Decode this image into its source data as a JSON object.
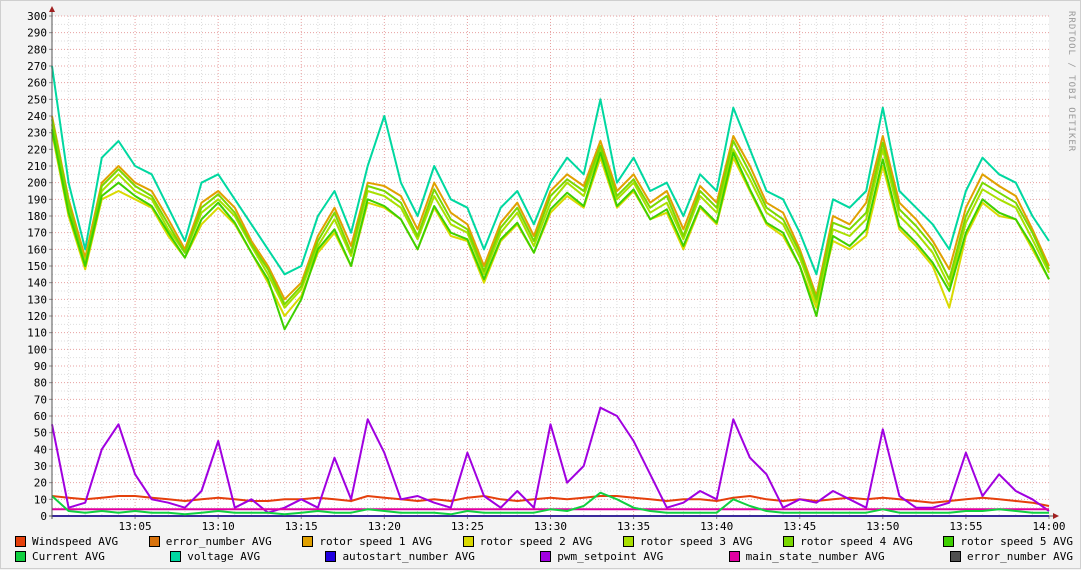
{
  "watermark": "RRDTOOL / TOBI OETIKER",
  "chart_data": {
    "type": "line",
    "title": "",
    "xlabel": "",
    "ylabel": "",
    "ylim": [
      0,
      300
    ],
    "yticks": [
      "0",
      "10",
      "20",
      "30",
      "40",
      "50",
      "60",
      "70",
      "80",
      "90",
      "100",
      "110",
      "120",
      "130",
      "140",
      "150",
      "160",
      "170",
      "180",
      "190",
      "200",
      "210",
      "220",
      "230",
      "240",
      "250",
      "260",
      "270",
      "280",
      "290",
      "300"
    ],
    "xrange_minutes": [
      0,
      60
    ],
    "xticks": [
      {
        "minute": 5,
        "label": "13:05"
      },
      {
        "minute": 10,
        "label": "13:10"
      },
      {
        "minute": 15,
        "label": "13:15"
      },
      {
        "minute": 20,
        "label": "13:20"
      },
      {
        "minute": 25,
        "label": "13:25"
      },
      {
        "minute": 30,
        "label": "13:30"
      },
      {
        "minute": 35,
        "label": "13:35"
      },
      {
        "minute": 40,
        "label": "13:40"
      },
      {
        "minute": 45,
        "label": "13:45"
      },
      {
        "minute": 50,
        "label": "13:50"
      },
      {
        "minute": 55,
        "label": "13:55"
      },
      {
        "minute": 60,
        "label": "14:00"
      }
    ],
    "grid": true,
    "legend_placement": "bottom",
    "series": [
      {
        "name": "Windspeed AVG",
        "color": "#e5400c",
        "values": [
          12,
          11,
          10,
          11,
          12,
          12,
          11,
          10,
          9,
          10,
          11,
          10,
          9,
          9,
          10,
          10,
          11,
          10,
          9,
          12,
          11,
          10,
          9,
          10,
          9,
          11,
          12,
          10,
          9,
          10,
          11,
          10,
          11,
          12,
          12,
          11,
          10,
          9,
          10,
          10,
          9,
          11,
          12,
          10,
          9,
          10,
          9,
          10,
          11,
          10,
          11,
          10,
          9,
          8,
          9,
          10,
          11,
          10,
          9,
          8,
          6
        ]
      },
      {
        "name": "error_number AVG",
        "color": "#d8720c",
        "values": [
          0,
          0,
          0,
          0,
          0,
          0,
          0,
          0,
          0,
          0,
          0,
          0,
          0,
          0,
          0,
          0,
          0,
          0,
          0,
          0,
          0,
          0,
          0,
          0,
          0,
          0,
          0,
          0,
          0,
          0,
          0,
          0,
          0,
          0,
          0,
          0,
          0,
          0,
          0,
          0,
          0,
          0,
          0,
          0,
          0,
          0,
          0,
          0,
          0,
          0,
          0,
          0,
          0,
          0,
          0,
          0,
          0,
          0,
          0,
          0,
          0
        ]
      },
      {
        "name": "rotor speed 1 AVG",
        "color": "#e0a000",
        "values": [
          240,
          190,
          155,
          200,
          210,
          200,
          195,
          178,
          160,
          188,
          195,
          185,
          165,
          150,
          130,
          140,
          168,
          185,
          162,
          200,
          198,
          192,
          172,
          200,
          182,
          175,
          150,
          176,
          188,
          168,
          195,
          205,
          198,
          225,
          195,
          205,
          188,
          195,
          172,
          198,
          188,
          228,
          210,
          188,
          182,
          160,
          132,
          180,
          175,
          188,
          228,
          188,
          178,
          165,
          148,
          185,
          205,
          198,
          192,
          172,
          150
        ]
      },
      {
        "name": "rotor speed 2 AVG",
        "color": "#d9d900",
        "values": [
          230,
          180,
          148,
          190,
          195,
          190,
          185,
          168,
          155,
          175,
          185,
          175,
          158,
          140,
          120,
          132,
          158,
          170,
          150,
          188,
          185,
          178,
          160,
          185,
          168,
          165,
          140,
          165,
          175,
          158,
          182,
          192,
          185,
          215,
          185,
          195,
          178,
          182,
          160,
          185,
          175,
          215,
          195,
          175,
          168,
          150,
          125,
          165,
          160,
          168,
          210,
          172,
          162,
          150,
          125,
          168,
          188,
          180,
          178,
          160,
          142
        ]
      },
      {
        "name": "rotor speed 3 AVG",
        "color": "#a8e000",
        "values": [
          235,
          185,
          152,
          195,
          205,
          195,
          190,
          172,
          158,
          182,
          190,
          180,
          162,
          145,
          125,
          136,
          162,
          178,
          156,
          195,
          192,
          185,
          166,
          192,
          175,
          170,
          145,
          170,
          182,
          162,
          188,
          200,
          192,
          220,
          190,
          200,
          182,
          188,
          166,
          192,
          182,
          220,
          202,
          182,
          175,
          155,
          128,
          172,
          168,
          178,
          220,
          180,
          170,
          158,
          138,
          176,
          196,
          190,
          185,
          166,
          146
        ]
      },
      {
        "name": "rotor speed 4 AVG",
        "color": "#7ad800",
        "values": [
          238,
          188,
          150,
          198,
          208,
          198,
          192,
          175,
          158,
          185,
          193,
          182,
          163,
          148,
          127,
          138,
          165,
          182,
          158,
          198,
          195,
          188,
          168,
          196,
          178,
          172,
          147,
          173,
          185,
          165,
          192,
          202,
          195,
          222,
          192,
          202,
          185,
          192,
          168,
          195,
          185,
          225,
          206,
          185,
          178,
          158,
          130,
          176,
          172,
          182,
          224,
          184,
          174,
          162,
          142,
          180,
          200,
          194,
          188,
          170,
          148
        ]
      },
      {
        "name": "rotor speed 5 AVG",
        "color": "#3ed000",
        "values": [
          232,
          182,
          150,
          192,
          200,
          192,
          186,
          170,
          155,
          178,
          188,
          176,
          158,
          142,
          112,
          130,
          160,
          172,
          150,
          190,
          186,
          178,
          160,
          186,
          170,
          166,
          142,
          166,
          176,
          158,
          184,
          194,
          186,
          218,
          186,
          196,
          178,
          184,
          162,
          186,
          176,
          218,
          196,
          176,
          170,
          150,
          120,
          168,
          162,
          172,
          214,
          174,
          164,
          152,
          135,
          170,
          190,
          182,
          178,
          162,
          142
        ]
      },
      {
        "name": "Current AVG",
        "color": "#10d040",
        "values": [
          12,
          3,
          2,
          3,
          2,
          3,
          2,
          2,
          1,
          2,
          3,
          2,
          2,
          2,
          1,
          2,
          3,
          2,
          2,
          4,
          3,
          2,
          2,
          2,
          1,
          3,
          2,
          2,
          2,
          2,
          4,
          3,
          6,
          14,
          10,
          5,
          3,
          2,
          2,
          2,
          2,
          10,
          6,
          3,
          2,
          2,
          2,
          2,
          2,
          2,
          4,
          2,
          2,
          2,
          2,
          3,
          3,
          4,
          3,
          2,
          2
        ]
      },
      {
        "name": "voltage AVG",
        "color": "#00d8a0",
        "values": [
          270,
          200,
          160,
          215,
          225,
          210,
          205,
          185,
          165,
          200,
          205,
          190,
          175,
          160,
          145,
          150,
          180,
          195,
          170,
          210,
          240,
          200,
          180,
          210,
          190,
          185,
          160,
          185,
          195,
          175,
          200,
          215,
          205,
          250,
          200,
          215,
          195,
          200,
          180,
          205,
          195,
          245,
          220,
          195,
          190,
          170,
          145,
          190,
          185,
          195,
          245,
          195,
          185,
          175,
          160,
          195,
          215,
          205,
          200,
          180,
          165
        ]
      },
      {
        "name": "autostart_number AVG",
        "color": "#2000e0",
        "values": [
          0,
          0,
          0,
          0,
          0,
          0,
          0,
          0,
          0,
          0,
          0,
          0,
          0,
          0,
          0,
          0,
          0,
          0,
          0,
          0,
          0,
          0,
          0,
          0,
          0,
          0,
          0,
          0,
          0,
          0,
          0,
          0,
          0,
          0,
          0,
          0,
          0,
          0,
          0,
          0,
          0,
          0,
          0,
          0,
          0,
          0,
          0,
          0,
          0,
          0,
          0,
          0,
          0,
          0,
          0,
          0,
          0,
          0,
          0,
          0,
          0
        ]
      },
      {
        "name": "pwm_setpoint AVG",
        "color": "#a000e0",
        "values": [
          55,
          5,
          8,
          40,
          55,
          25,
          10,
          8,
          5,
          15,
          45,
          5,
          10,
          2,
          5,
          10,
          5,
          35,
          10,
          58,
          38,
          10,
          12,
          8,
          5,
          38,
          12,
          5,
          15,
          5,
          55,
          20,
          30,
          65,
          60,
          45,
          25,
          5,
          8,
          15,
          10,
          58,
          35,
          25,
          5,
          10,
          8,
          15,
          10,
          5,
          52,
          12,
          5,
          5,
          8,
          38,
          12,
          25,
          15,
          10,
          3
        ]
      },
      {
        "name": "main_state_number AVG",
        "color": "#e000a0",
        "values": [
          4,
          4,
          4,
          4,
          4,
          4,
          4,
          4,
          4,
          4,
          4,
          4,
          4,
          4,
          4,
          4,
          4,
          4,
          4,
          4,
          4,
          4,
          4,
          4,
          4,
          4,
          4,
          4,
          4,
          4,
          4,
          4,
          4,
          4,
          4,
          4,
          4,
          4,
          4,
          4,
          4,
          4,
          4,
          4,
          4,
          4,
          4,
          4,
          4,
          4,
          4,
          4,
          4,
          4,
          4,
          4,
          4,
          4,
          4,
          4,
          4
        ]
      },
      {
        "name": "error_number AVG",
        "color": "#505050",
        "values": [
          0,
          0,
          0,
          0,
          0,
          0,
          0,
          0,
          0,
          0,
          0,
          0,
          0,
          0,
          0,
          0,
          0,
          0,
          0,
          0,
          0,
          0,
          0,
          0,
          0,
          0,
          0,
          0,
          0,
          0,
          0,
          0,
          0,
          0,
          0,
          0,
          0,
          0,
          0,
          0,
          0,
          0,
          0,
          0,
          0,
          0,
          0,
          0,
          0,
          0,
          0,
          0,
          0,
          0,
          0,
          0,
          0,
          0,
          0,
          0,
          0
        ]
      }
    ]
  }
}
